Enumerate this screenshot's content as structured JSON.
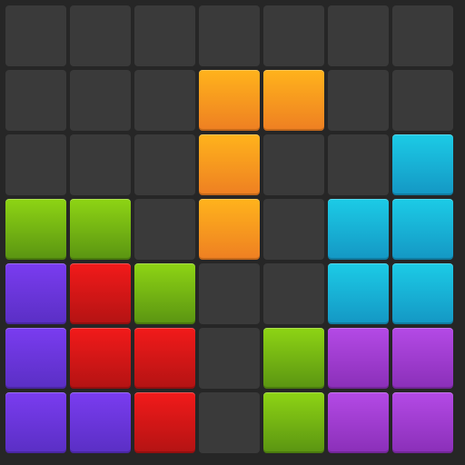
{
  "board": {
    "rows": 7,
    "cols": 7,
    "empty_color": "#3a3a3a",
    "palette": {
      "orange": [
        "#ffb31c",
        "#ee7f22"
      ],
      "cyan": [
        "#1ccbe6",
        "#1497c4"
      ],
      "green": [
        "#8ed414",
        "#5a9412"
      ],
      "purple": [
        "#7a3cf0",
        "#5a2fc4"
      ],
      "red": [
        "#f21a1a",
        "#b31313"
      ],
      "violet": [
        "#b44ae6",
        "#8a2fb8"
      ]
    },
    "grid": [
      [
        null,
        null,
        null,
        null,
        null,
        null,
        null
      ],
      [
        null,
        null,
        null,
        "orange",
        "orange",
        null,
        null
      ],
      [
        null,
        null,
        null,
        "orange",
        null,
        null,
        "cyan"
      ],
      [
        "green",
        "green",
        null,
        "orange",
        null,
        "cyan",
        "cyan"
      ],
      [
        "purple",
        "red",
        "green",
        null,
        null,
        "cyan",
        "cyan"
      ],
      [
        "purple",
        "red",
        "red",
        null,
        "green",
        "violet",
        "violet"
      ],
      [
        "purple",
        "purple",
        "red",
        null,
        "green",
        "violet",
        "violet"
      ]
    ]
  }
}
